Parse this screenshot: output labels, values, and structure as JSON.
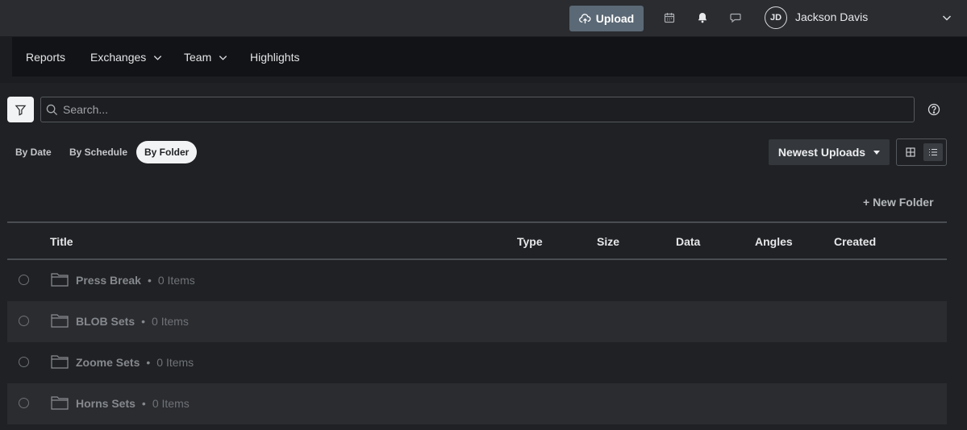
{
  "topbar": {
    "upload_label": "Upload",
    "user_initials": "JD",
    "user_name": "Jackson Davis"
  },
  "nav": {
    "items": [
      {
        "label": "Reports",
        "has_dropdown": false
      },
      {
        "label": "Exchanges",
        "has_dropdown": true
      },
      {
        "label": "Team",
        "has_dropdown": true
      },
      {
        "label": "Highlights",
        "has_dropdown": false
      }
    ]
  },
  "search": {
    "placeholder": "Search...",
    "value": ""
  },
  "view_tabs": [
    {
      "label": "By Date",
      "active": false
    },
    {
      "label": "By Schedule",
      "active": false
    },
    {
      "label": "By Folder",
      "active": true
    }
  ],
  "sort": {
    "selected": "Newest Uploads"
  },
  "new_folder_label": "+ New Folder",
  "table": {
    "columns": [
      "Title",
      "Type",
      "Size",
      "Data",
      "Angles",
      "Created"
    ],
    "rows": [
      {
        "title": "Press Break",
        "count": "0 Items"
      },
      {
        "title": "BLOB Sets",
        "count": "0 Items"
      },
      {
        "title": "Zoome Sets",
        "count": "0 Items"
      },
      {
        "title": "Horns Sets",
        "count": "0 Items"
      }
    ]
  },
  "colors": {
    "topbar_bg": "#2a2c30",
    "navbar_bg": "#121316",
    "upload_button": "#5b6875",
    "active_tab_bg": "#f2f3f4"
  }
}
